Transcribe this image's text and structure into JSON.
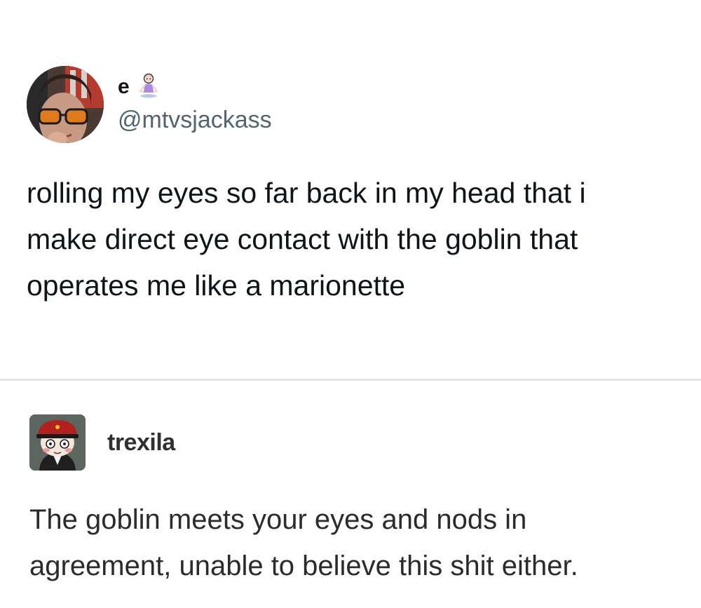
{
  "tweet": {
    "display_name": "e",
    "name_emoji": "person-in-lotus-position-icon",
    "handle": "@mtvsjackass",
    "text": "rolling my eyes so far back in my head that i\nmake direct eye contact with the goblin that\noperates me like a marionette"
  },
  "reply": {
    "username": "trexila",
    "text": "The goblin meets your eyes and nods in\nagreement, unable to believe this shit either."
  },
  "colors": {
    "text_primary": "#0f1419",
    "text_secondary": "#536471",
    "divider": "#e3e3e3",
    "reply_text": "#2b2b2b"
  }
}
